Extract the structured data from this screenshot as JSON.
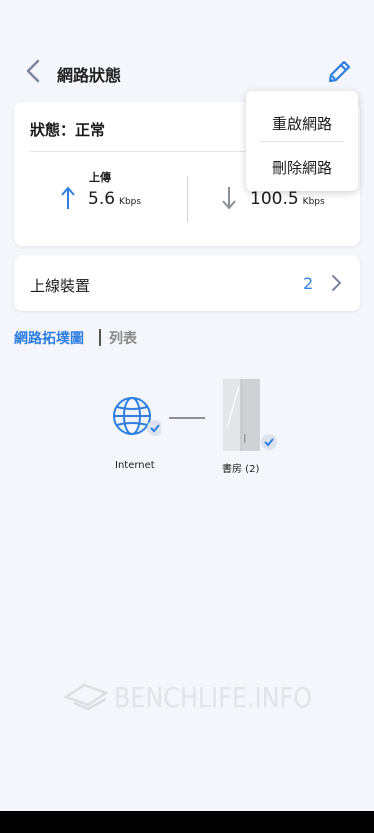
{
  "header": {
    "title": "網路狀態"
  },
  "status": {
    "label": "狀態：正常",
    "upload_label": "上傳",
    "upload_value": "5.6",
    "upload_unit": "Kbps",
    "download_value": "100.5",
    "download_unit": "Kbps"
  },
  "menu": {
    "items": [
      "重啟網路",
      "刪除網路"
    ]
  },
  "devices": {
    "label": "上線裝置",
    "count": "2"
  },
  "tabs": {
    "topology": "網路拓墣圖",
    "list": "列表"
  },
  "topology": {
    "internet_label": "Internet",
    "router_label": "書房 (2)"
  },
  "watermark": {
    "text": "BENCHLIFE.INFO"
  },
  "colors": {
    "accent": "#2f7fe0",
    "background": "#f4f6fb"
  }
}
